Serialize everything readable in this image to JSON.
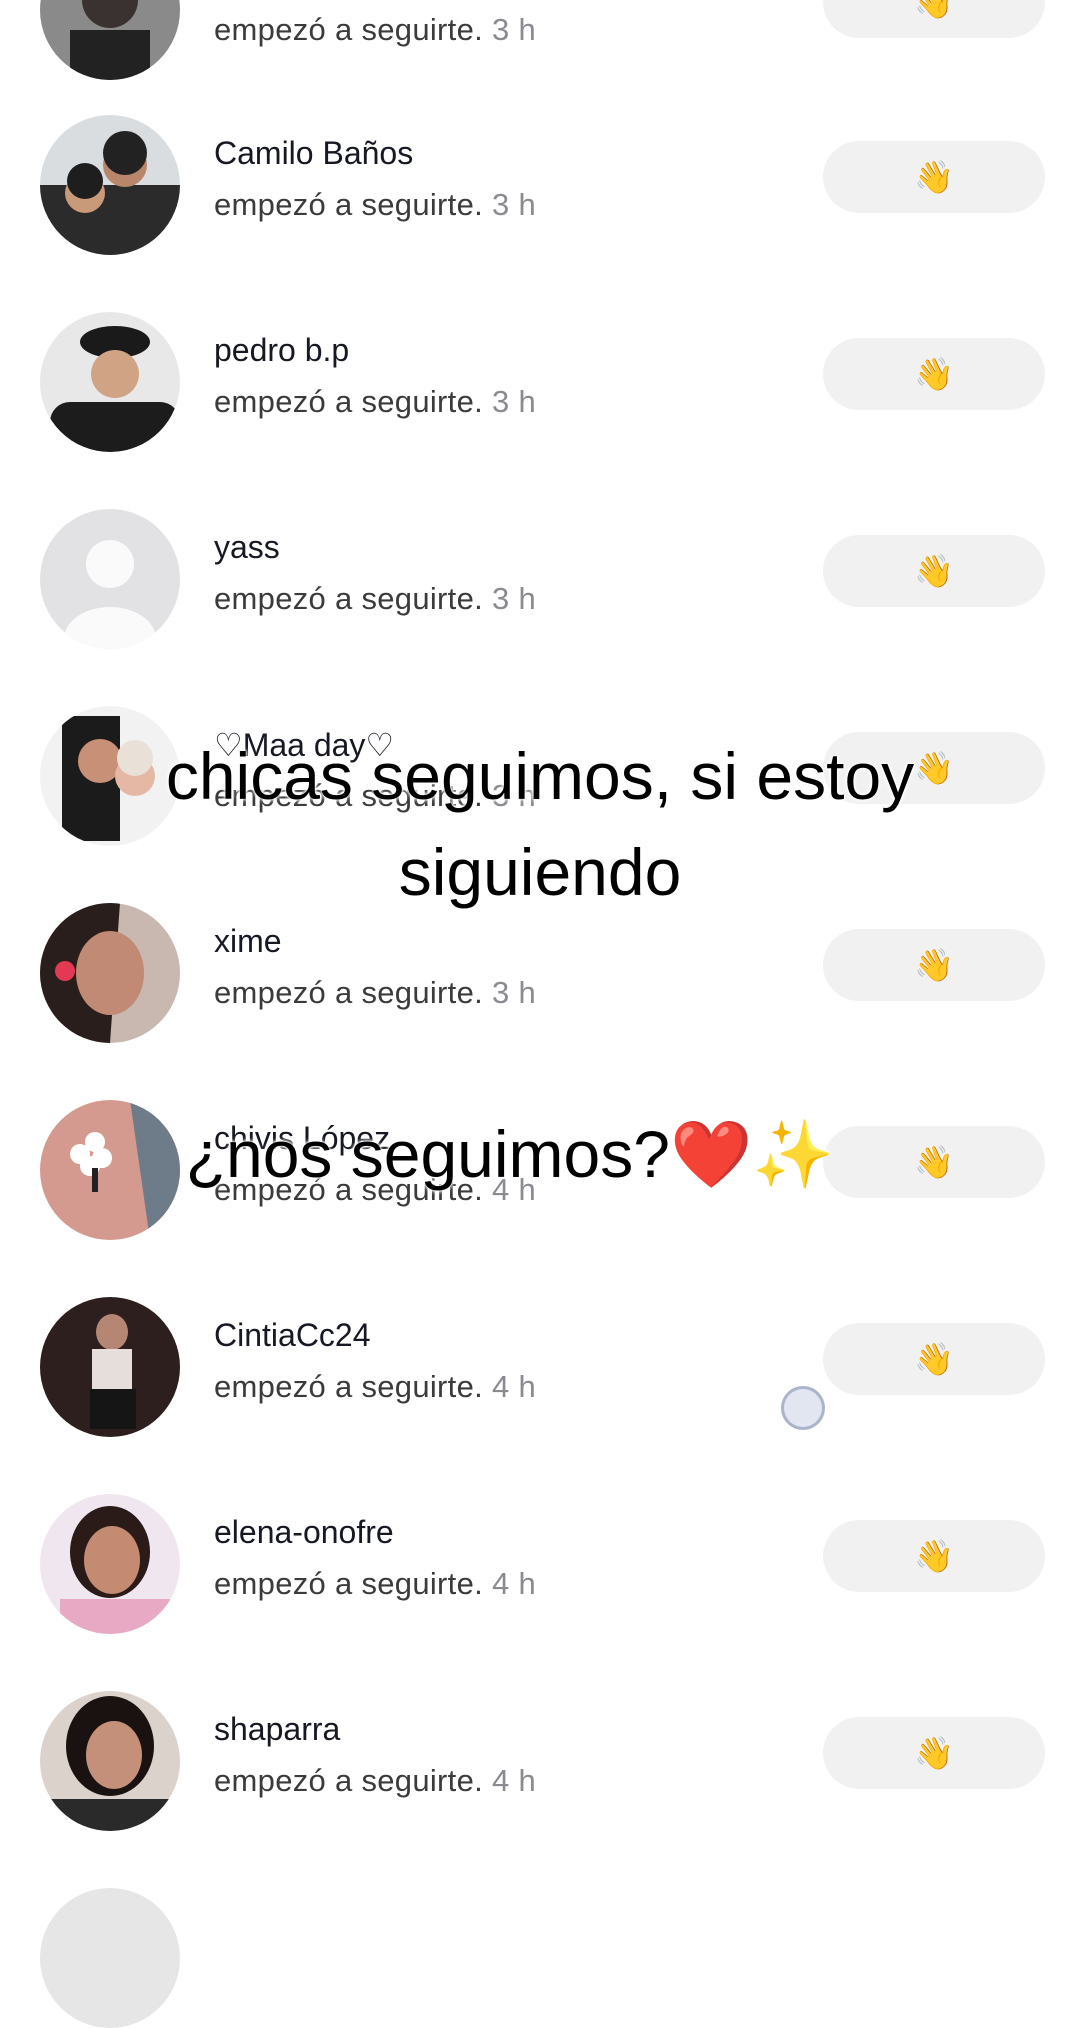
{
  "followers": [
    {
      "name": "",
      "action": "empezó a seguirte.",
      "time": "3 h",
      "avatar": "photo-avatar",
      "button_icon": "👋"
    },
    {
      "name": "Camilo Baños",
      "action": "empezó a seguirte.",
      "time": "3 h",
      "avatar": "photo-avatar",
      "button_icon": "👋"
    },
    {
      "name": "pedro b.p",
      "action": "empezó a seguirte.",
      "time": "3 h",
      "avatar": "photo-avatar",
      "button_icon": "👋"
    },
    {
      "name": "yass",
      "action": "empezó a seguirte.",
      "time": "3 h",
      "avatar": "default-avatar",
      "button_icon": "👋"
    },
    {
      "name": "♡Maa day♡",
      "action": "empezó a seguirte.",
      "time": "3 h",
      "avatar": "photo-avatar",
      "button_icon": "👋"
    },
    {
      "name": "xime",
      "action": "empezó a seguirte.",
      "time": "3 h",
      "avatar": "photo-avatar",
      "button_icon": "👋"
    },
    {
      "name": "chivis López",
      "action": "empezó a seguirte.",
      "time": "4 h",
      "avatar": "photo-avatar",
      "button_icon": "👋"
    },
    {
      "name": "CintiaCc24",
      "action": "empezó a seguirte.",
      "time": "4 h",
      "avatar": "photo-avatar",
      "button_icon": "👋"
    },
    {
      "name": "elena-onofre",
      "action": "empezó a seguirte.",
      "time": "4 h",
      "avatar": "photo-avatar",
      "button_icon": "👋"
    },
    {
      "name": "shaparra",
      "action": "empezó a seguirte.",
      "time": "4 h",
      "avatar": "photo-avatar",
      "button_icon": "👋"
    }
  ],
  "overlay": {
    "line1": "chicas seguimos, si estoy",
    "line2": "siguiendo",
    "line3": "¿nos seguimos?❤️✨"
  },
  "colors": {
    "button_bg": "#f1f1f2",
    "name_text": "#161823",
    "time_text": "#8a8b91"
  }
}
